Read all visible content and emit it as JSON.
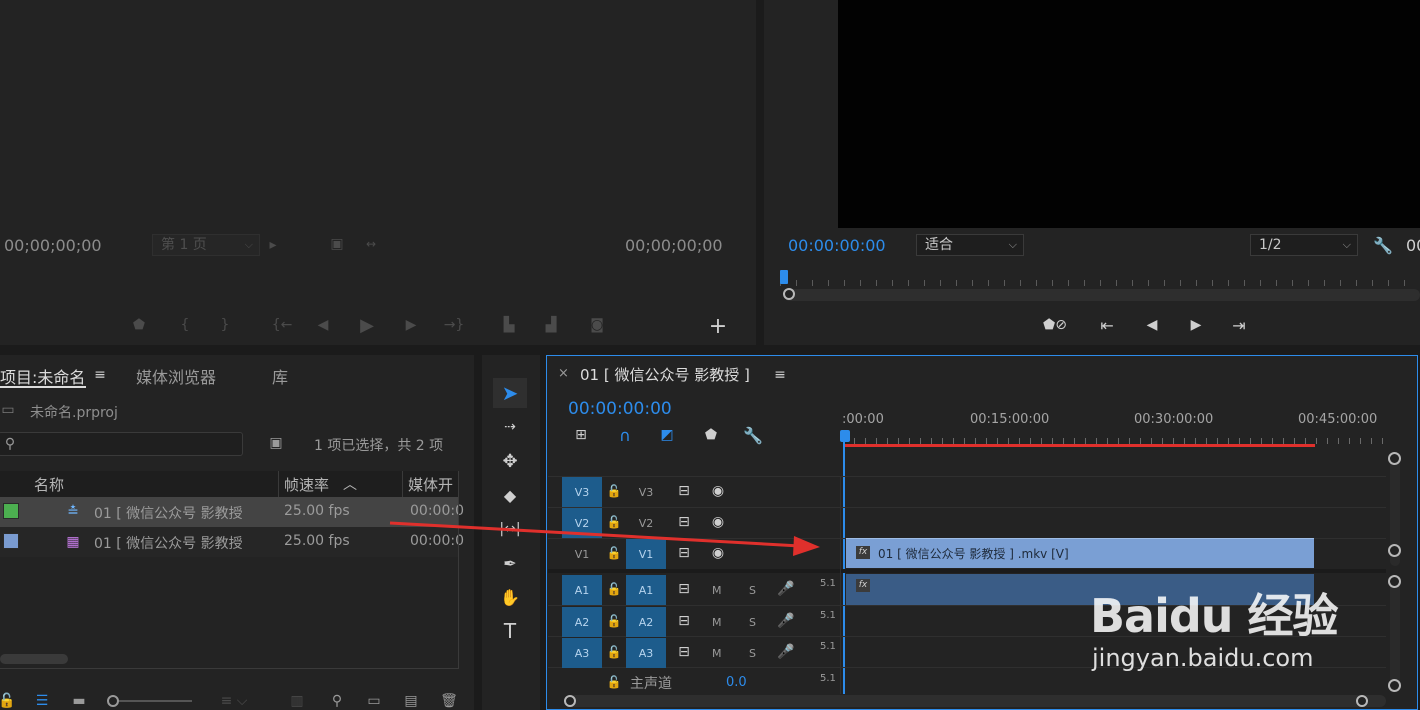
{
  "source_monitor": {
    "tc_left": "00;00;00;00",
    "tc_right": "00;00;00;00",
    "page_select": "第 1 页"
  },
  "program_monitor": {
    "timecode": "00:00:00:00",
    "fit_select": "适合",
    "resolution_select": "1/2",
    "tc_right_partial": "00"
  },
  "project_panel": {
    "tabs": [
      "项目:未命名",
      "媒体浏览器",
      "库"
    ],
    "project_file": "未命名.prproj",
    "selection_status": "1 项已选择，共 2 项",
    "columns": [
      "名称",
      "帧速率",
      "媒体开"
    ],
    "items": [
      {
        "name": "01 [ 微信公众号 影教授",
        "fps": "25.00 fps",
        "start": "00:00:0",
        "label_color": "#4caf50"
      },
      {
        "name": "01 [ 微信公众号 影教授",
        "fps": "25.00 fps",
        "start": "00:00:0",
        "label_color": "#7a9bd0"
      }
    ]
  },
  "timeline": {
    "close_glyph": "×",
    "sequence_name": "01 [ 微信公众号 影教授 ]",
    "timecode": "00:00:00:00",
    "ruler_labels": [
      ":00:00",
      "00:15:00:00",
      "00:30:00:00",
      "00:45:00:00"
    ],
    "video_tracks": [
      {
        "target": "V3",
        "name": "V3"
      },
      {
        "target": "V2",
        "name": "V2"
      },
      {
        "target": "V1",
        "name": "V1"
      }
    ],
    "audio_tracks": [
      {
        "target": "A1",
        "name": "A1",
        "m": "M",
        "s": "S"
      },
      {
        "target": "A2",
        "name": "A2",
        "m": "M",
        "s": "S"
      },
      {
        "target": "A3",
        "name": "A3",
        "m": "M",
        "s": "S"
      }
    ],
    "master_label": "主声道",
    "master_value": "0.0",
    "channel_label": "5.1",
    "clip_label": "01 [ 微信公众号 影教授 ] .mkv [V]",
    "fx_badge": "fx"
  },
  "watermark": {
    "brand": "Baidu 经验",
    "url": "jingyan.baidu.com"
  },
  "colors": {
    "accent_blue": "#2d8ceb",
    "video_clip": "#7a9fd4",
    "audio_clip": "#3a5c86",
    "track_target": "#1d5c8c",
    "red_line": "#e0302c"
  }
}
